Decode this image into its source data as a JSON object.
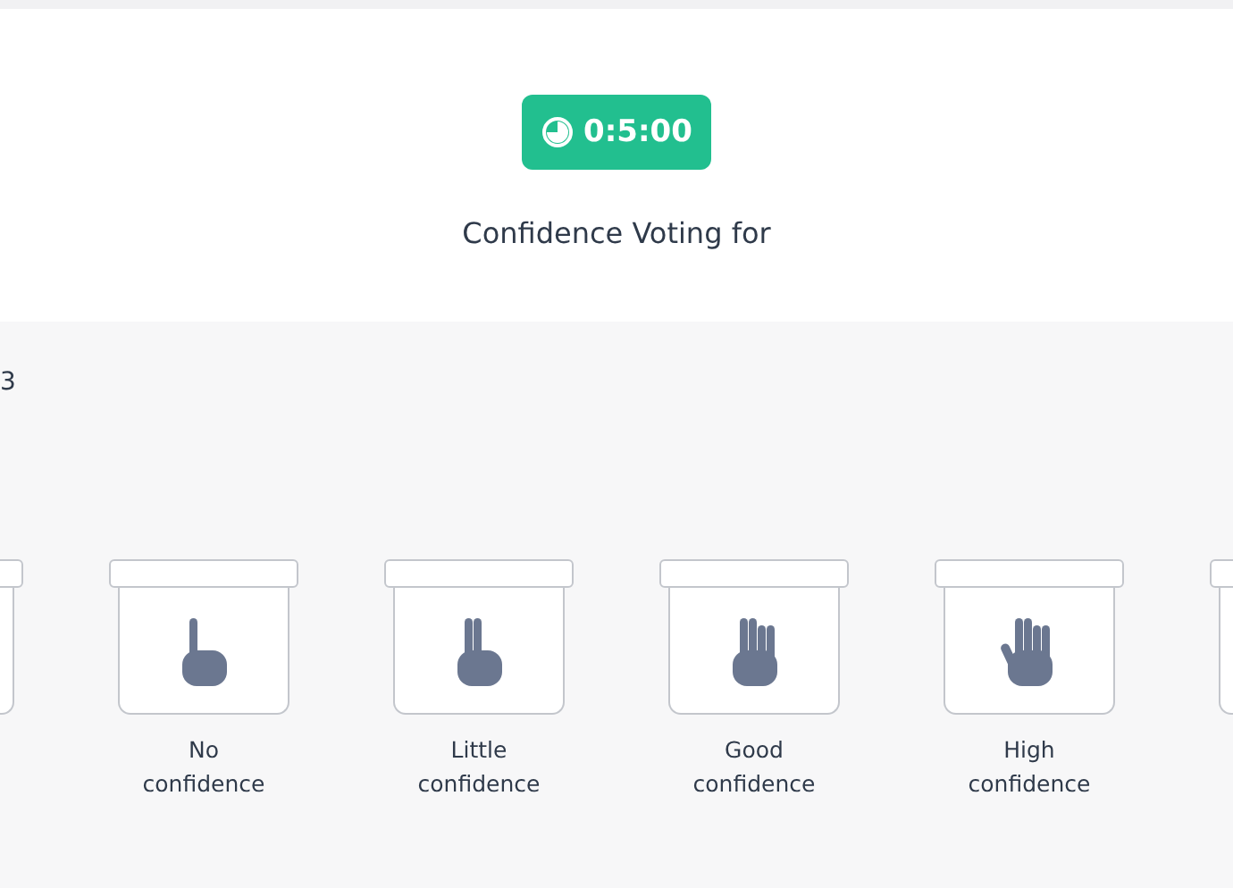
{
  "timer": {
    "text": "0:5:00"
  },
  "title": "Confidence Voting for",
  "side_label": "3",
  "options": [
    {
      "kind": "one",
      "label": [
        "No",
        "confidence"
      ]
    },
    {
      "kind": "two",
      "label": [
        "Little",
        "confidence"
      ]
    },
    {
      "kind": "four",
      "label": [
        "Good",
        "confidence"
      ]
    },
    {
      "kind": "five",
      "label": [
        "High",
        "confidence"
      ]
    }
  ]
}
